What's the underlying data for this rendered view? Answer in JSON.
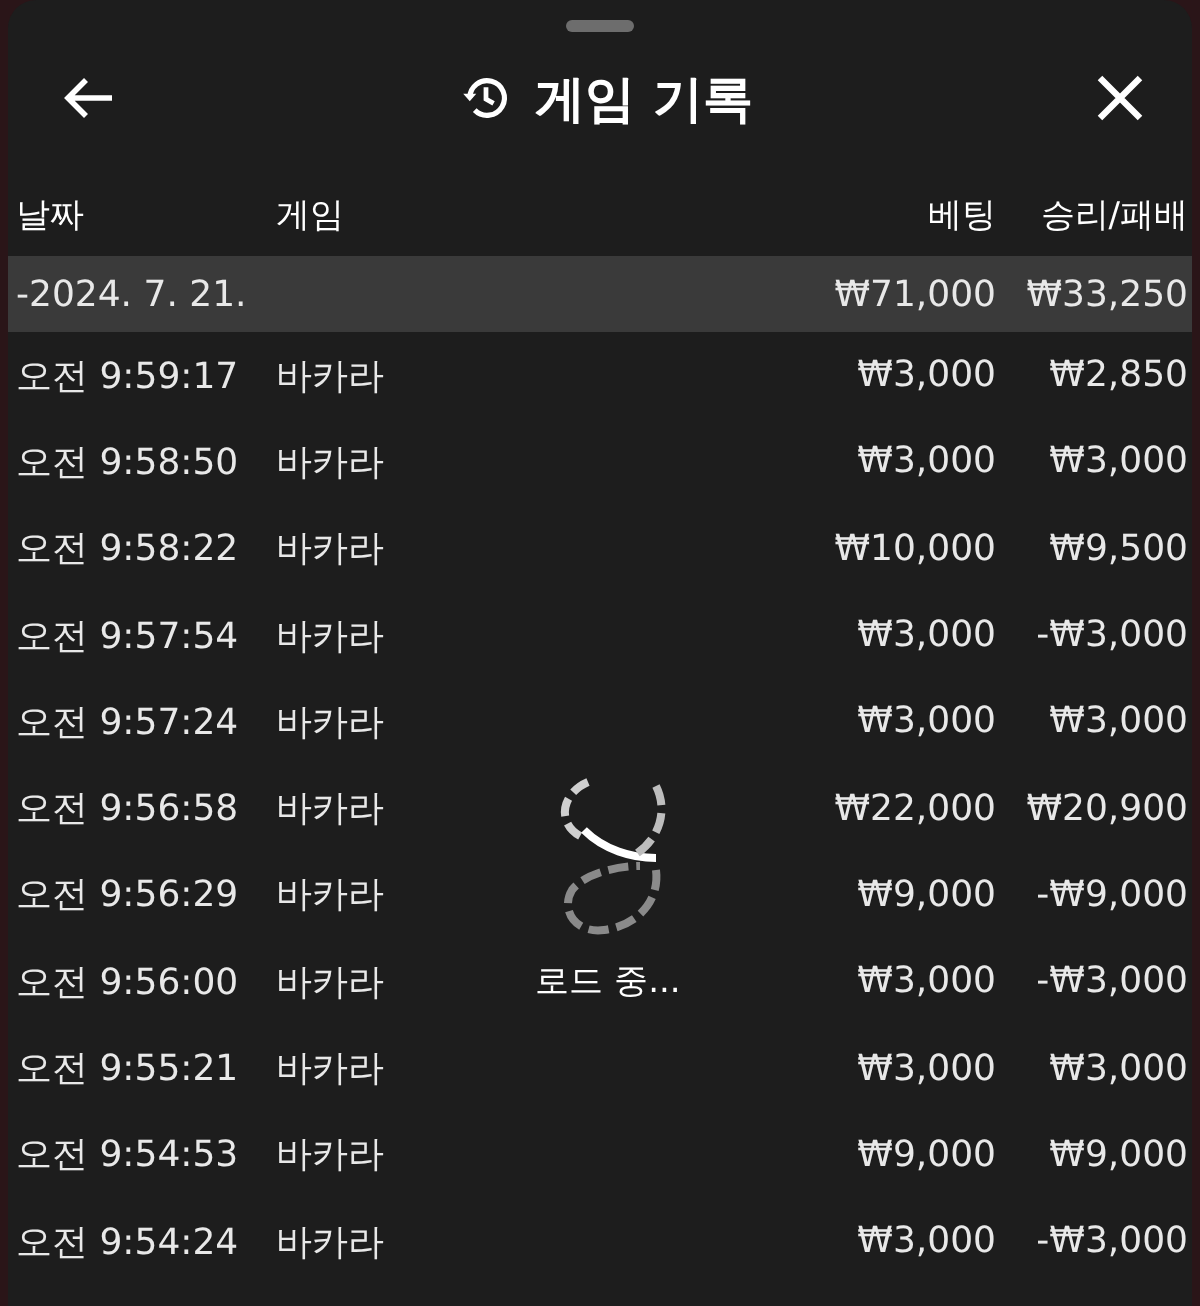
{
  "header": {
    "title": "게임 기록"
  },
  "columns": [
    "날짜",
    "게임",
    "베팅",
    "승리/패배"
  ],
  "date_group": {
    "date": "-2024. 7. 21.",
    "bet": "₩71,000",
    "result": "₩33,250",
    "selected": true
  },
  "rows": [
    {
      "time": "오전 9:59:17",
      "game": "바카라",
      "bet": "₩3,000",
      "result": "₩2,850"
    },
    {
      "time": "오전 9:58:50",
      "game": "바카라",
      "bet": "₩3,000",
      "result": "₩3,000"
    },
    {
      "time": "오전 9:58:22",
      "game": "바카라",
      "bet": "₩10,000",
      "result": "₩9,500"
    },
    {
      "time": "오전 9:57:54",
      "game": "바카라",
      "bet": "₩3,000",
      "result": "-₩3,000"
    },
    {
      "time": "오전 9:57:24",
      "game": "바카라",
      "bet": "₩3,000",
      "result": "₩3,000"
    },
    {
      "time": "오전 9:56:58",
      "game": "바카라",
      "bet": "₩22,000",
      "result": "₩20,900"
    },
    {
      "time": "오전 9:56:29",
      "game": "바카라",
      "bet": "₩9,000",
      "result": "-₩9,000"
    },
    {
      "time": "오전 9:56:00",
      "game": "바카라",
      "bet": "₩3,000",
      "result": "-₩3,000"
    },
    {
      "time": "오전 9:55:21",
      "game": "바카라",
      "bet": "₩3,000",
      "result": "₩3,000"
    },
    {
      "time": "오전 9:54:53",
      "game": "바카라",
      "bet": "₩9,000",
      "result": "₩9,000"
    },
    {
      "time": "오전 9:54:24",
      "game": "바카라",
      "bet": "₩3,000",
      "result": "-₩3,000"
    }
  ],
  "loading": {
    "label": "로드 중..."
  }
}
